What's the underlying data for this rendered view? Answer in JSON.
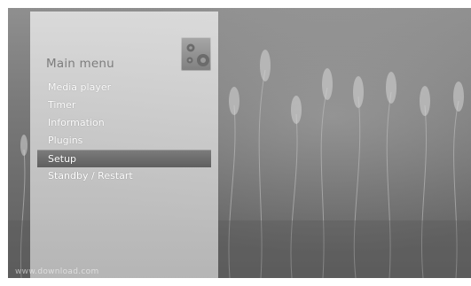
{
  "menu": {
    "title": "Main menu",
    "icon": "setup-gears-icon",
    "items": [
      {
        "label": "Media player",
        "selected": false
      },
      {
        "label": "Timer",
        "selected": false
      },
      {
        "label": "Information",
        "selected": false
      },
      {
        "label": "Plugins",
        "selected": false
      },
      {
        "label": "Setup",
        "selected": true
      },
      {
        "label": "Standby / Restart",
        "selected": false
      }
    ]
  },
  "watermark": {
    "text": "www.download.com"
  },
  "colors": {
    "panel": "#d9d9d9",
    "selection": "#6c6c6c",
    "text": "#ffffff",
    "title": "#7d7d7d"
  }
}
